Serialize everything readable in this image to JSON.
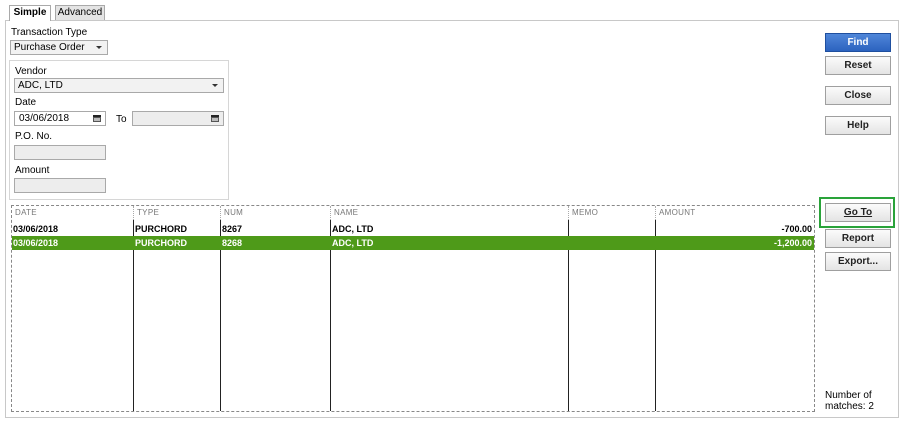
{
  "tabs": [
    {
      "label": "Simple",
      "active": true
    },
    {
      "label": "Advanced",
      "active": false
    }
  ],
  "form": {
    "transaction_type_label": "Transaction Type",
    "transaction_type_value": "Purchase Order",
    "vendor_label": "Vendor",
    "vendor_value": "ADC, LTD",
    "date_label": "Date",
    "date_from": "03/06/2018",
    "to_label": "To",
    "date_to": "",
    "po_label": "P.O. No.",
    "po_value": "",
    "amount_label": "Amount",
    "amount_value": ""
  },
  "table": {
    "columns": [
      "DATE",
      "TYPE",
      "NUM",
      "NAME",
      "MEMO",
      "AMOUNT"
    ],
    "rows": [
      {
        "date": "03/06/2018",
        "type": "PURCHORD",
        "num": "8267",
        "name": "ADC, LTD",
        "memo": "",
        "amount": "-700.00",
        "selected": false
      },
      {
        "date": "03/06/2018",
        "type": "PURCHORD",
        "num": "8268",
        "name": "ADC, LTD",
        "memo": "",
        "amount": "-1,200.00",
        "selected": true
      }
    ]
  },
  "buttons": {
    "find": "Find",
    "reset": "Reset",
    "close": "Close",
    "help": "Help",
    "goto": "Go To",
    "report": "Report",
    "export": "Export..."
  },
  "status": {
    "matches_line1": "Number of",
    "matches_line2": "matches: 2"
  },
  "colors": {
    "selected_row": "#4e9a19",
    "primary_button": "#2c63bf",
    "highlight_frame": "#2aa33a"
  }
}
